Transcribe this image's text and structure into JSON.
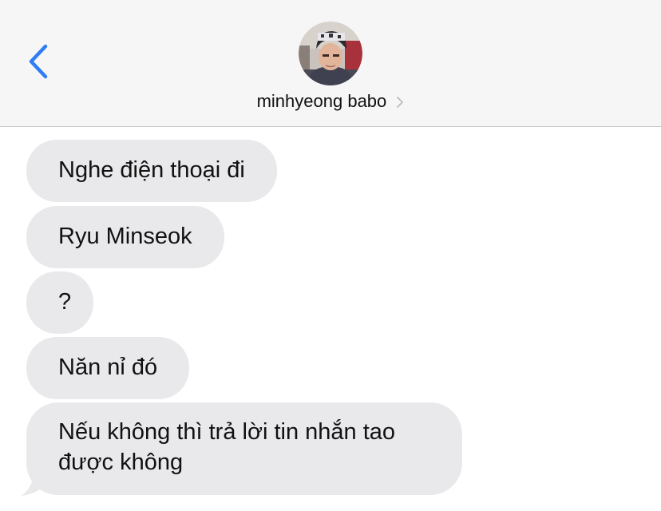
{
  "header": {
    "contact_name": "minhyeong babo",
    "icons": {
      "back": "chevron-left-icon",
      "avatar": "contact-avatar",
      "details": "chevron-right-icon"
    },
    "accent_color": "#2f7cf6"
  },
  "messages": [
    {
      "text": "Nghe điện thoại đi",
      "direction": "incoming"
    },
    {
      "text": "Ryu Minseok",
      "direction": "incoming"
    },
    {
      "text": "?",
      "direction": "incoming"
    },
    {
      "text": "Năn nỉ đó",
      "direction": "incoming"
    },
    {
      "text": "Nếu không thì trả lời tin nhắn tao được không",
      "direction": "incoming"
    }
  ],
  "colors": {
    "header_bg": "#f6f6f7",
    "incoming_bubble": "#e9e9eb"
  }
}
